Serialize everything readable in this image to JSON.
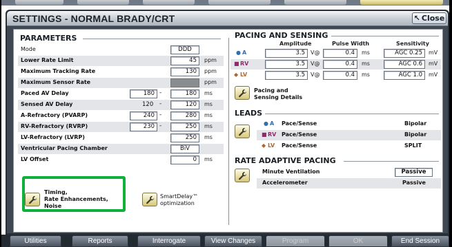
{
  "dialog": {
    "title": "SETTINGS - NORMAL BRADY/CRT",
    "close_label": "Close"
  },
  "parameters": {
    "header": "PARAMETERS",
    "rows": [
      {
        "label": "Mode",
        "value": "DDD",
        "unit": ""
      },
      {
        "label": "Lower Rate Limit",
        "value": "45",
        "unit": "ppm"
      },
      {
        "label": "Maximum Tracking Rate",
        "value": "130",
        "unit": "ppm"
      },
      {
        "label": "Maximum Sensor Rate",
        "value": "",
        "unit": "ppm"
      },
      {
        "label": "Paced AV Delay",
        "min": "180",
        "value": "180",
        "unit": "ms"
      },
      {
        "label": "Sensed AV Delay",
        "min": "120",
        "value": "120",
        "unit": "ms"
      },
      {
        "label": "A-Refractory (PVARP)",
        "min": "240",
        "value": "280",
        "unit": "ms"
      },
      {
        "label": "RV-Refractory (RVRP)",
        "min": "230",
        "value": "250",
        "unit": "ms"
      },
      {
        "label": "LV-Refractory (LVRP)",
        "value": "250",
        "unit": "ms"
      },
      {
        "label": "Ventricular Pacing Chamber",
        "value": "BiV",
        "unit": ""
      },
      {
        "label": "LV Offset",
        "value": "0",
        "unit": "ms"
      }
    ],
    "timing_button": {
      "line1": "Timing,",
      "line2": "Rate Enhancements,",
      "line3": "Noise"
    },
    "smartdelay_button": {
      "line1": "SmartDelay™",
      "line2": "optimization"
    }
  },
  "pacing": {
    "header": "PACING AND SENSING",
    "col_amplitude": "Amplitude",
    "col_pulse": "Pulse Width",
    "col_sensitivity": "Sensitivity",
    "rows": [
      {
        "chamber": "A",
        "marker": "●",
        "color": "#2f6fb4",
        "amp": "3.5",
        "amp_unit": "V@",
        "pw": "0.4",
        "pw_unit": "ms",
        "sens": "AGC 0.25",
        "sens_unit": "mV"
      },
      {
        "chamber": "RV",
        "marker": "■",
        "color": "#8e2a6e",
        "amp": "3.5",
        "amp_unit": "V@",
        "pw": "0.4",
        "pw_unit": "ms",
        "sens": "AGC 0.6",
        "sens_unit": "mV"
      },
      {
        "chamber": "LV",
        "marker": "◆",
        "color": "#b0662e",
        "amp": "3.5",
        "amp_unit": "V@",
        "pw": "0.4",
        "pw_unit": "ms",
        "sens": "AGC 1.0",
        "sens_unit": "mV"
      }
    ],
    "details_button": {
      "line1": "Pacing and",
      "line2": "Sensing Details"
    }
  },
  "leads": {
    "header": "LEADS",
    "rows": [
      {
        "chamber": "A",
        "marker": "●",
        "color": "#2f6fb4",
        "type": "Pace/Sense",
        "config": "Bipolar"
      },
      {
        "chamber": "RV",
        "marker": "■",
        "color": "#8e2a6e",
        "type": "Pace/Sense",
        "config": "Bipolar"
      },
      {
        "chamber": "LV",
        "marker": "◆",
        "color": "#b0662e",
        "type": "Pace/Sense",
        "config": "SPLIT"
      }
    ]
  },
  "rate_adaptive": {
    "header": "RATE ADAPTIVE PACING",
    "rows": [
      {
        "label": "Minute Ventilation",
        "value": "Passive"
      },
      {
        "label": "Accelerometer",
        "value": "Passive"
      }
    ]
  },
  "bottom_bar": {
    "utilities": "Utilities",
    "reports": "Reports",
    "interrogate": "Interrogate",
    "view_changes": "View Changes",
    "program": "Program",
    "ok": "OK",
    "end_session": "End Session"
  }
}
